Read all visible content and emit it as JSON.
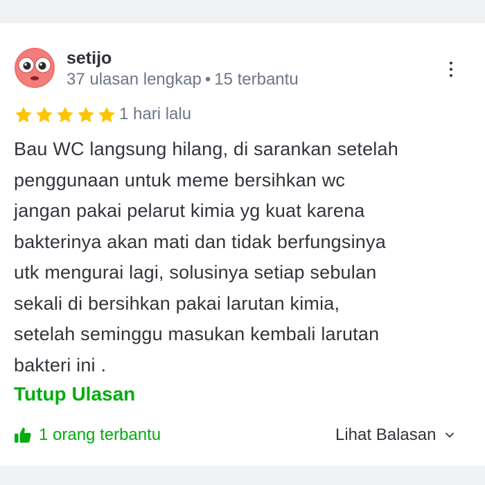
{
  "review": {
    "reviewer": {
      "name": "setijo",
      "reviews_count": "37 ulasan lengkap",
      "separator": "•",
      "helpful_count": "15 terbantu"
    },
    "rating": 5,
    "rating_max": 5,
    "date": "1 hari lalu",
    "text": "Bau WC langsung hilang, di sarankan setelah\npenggunaan untuk meme bersihkan wc\njangan pakai pelarut kimia yg kuat karena\nbakterinya akan mati dan tidak berfungsinya\nutk mengurai lagi, solusinya setiap sebulan\nsekali di bersihkan pakai larutan kimia,\nsetelah seminggu masukan kembali larutan\nbakteri ini .",
    "collapse_label": "Tutup Ulasan",
    "helpful_label": "1 orang terbantu",
    "replies_label": "Lihat Balasan"
  },
  "icons": {
    "avatar": "emoji-face-icon",
    "menu": "more-vertical-icon",
    "star": "star-icon",
    "helpful": "thumbs-up-icon",
    "expand": "chevron-down-icon"
  },
  "colors": {
    "accent": "#03AC0E",
    "star": "#FFC400",
    "text": "#31353B",
    "muted": "#6D7588",
    "avatar_bg": "#F07070",
    "background_band": "#F0F2F4"
  }
}
